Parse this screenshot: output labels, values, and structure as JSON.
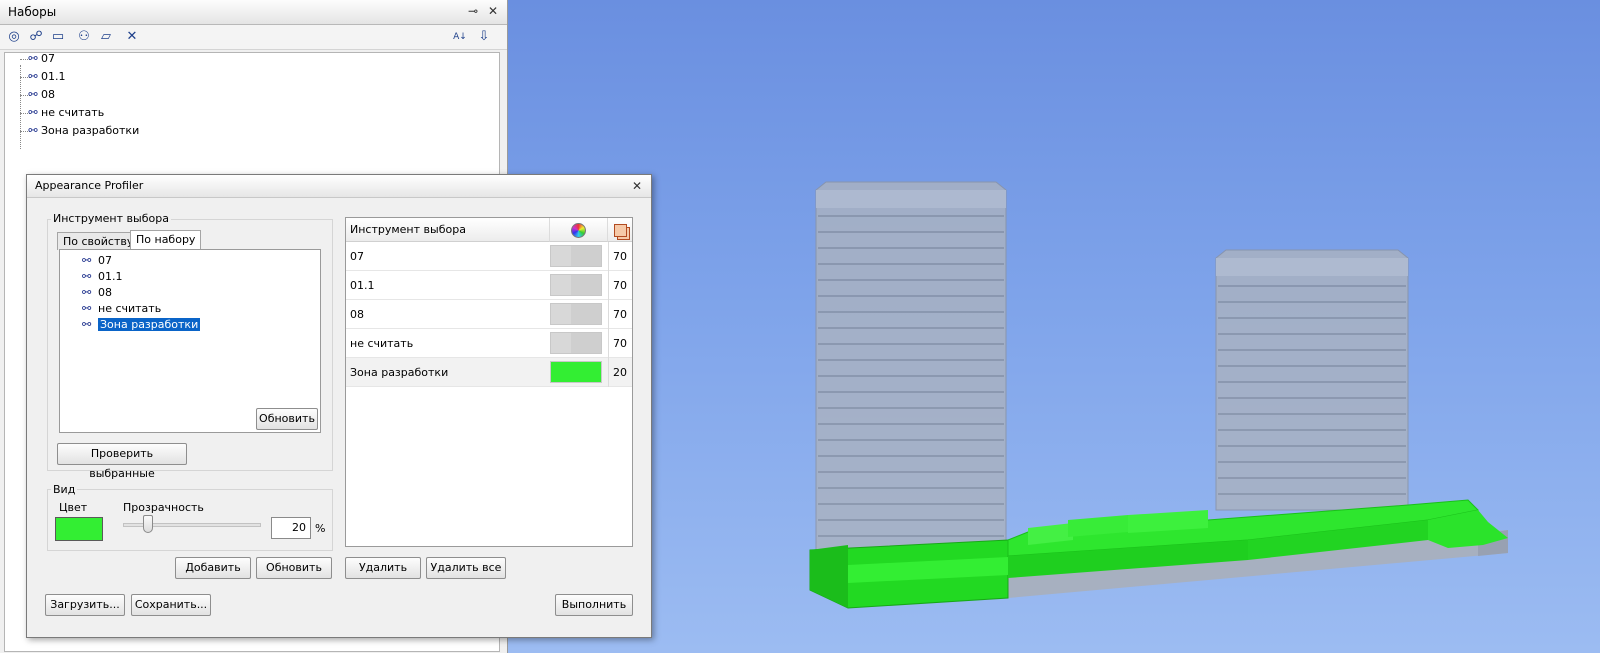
{
  "sets_panel": {
    "title": "Наборы",
    "pin_glyph": "⊸",
    "close_glyph": "✕",
    "toolbar": [
      {
        "icon": "save-selection-icon",
        "glyph": "◎"
      },
      {
        "icon": "save-search-icon",
        "glyph": "☍"
      },
      {
        "icon": "new-folder-icon",
        "glyph": "▭"
      },
      {
        "icon": "duplicate-icon",
        "glyph": "⚇"
      },
      {
        "icon": "add-comment-icon",
        "glyph": "▱"
      },
      {
        "icon": "delete-icon",
        "glyph": "✕"
      },
      {
        "icon": "sort-az-icon",
        "glyph": "A↓"
      },
      {
        "icon": "import-export-icon",
        "glyph": "⇩"
      }
    ],
    "items": [
      {
        "label": "07",
        "icon": "binoculars-icon"
      },
      {
        "label": "01.1",
        "icon": "binoculars-icon"
      },
      {
        "label": "08",
        "icon": "binoculars-icon"
      },
      {
        "label": "не считать",
        "icon": "binoculars-icon"
      },
      {
        "label": "Зона разработки",
        "icon": "binoculars-icon"
      }
    ]
  },
  "profiler": {
    "title": "Appearance Profiler",
    "close_glyph": "✕",
    "selector_group_label": "Инструмент выбора",
    "tabs": [
      {
        "label": "По свойству",
        "active": false
      },
      {
        "label": "По набору",
        "active": true
      }
    ],
    "set_list": [
      {
        "label": "07",
        "selected": false
      },
      {
        "label": "01.1",
        "selected": false
      },
      {
        "label": "08",
        "selected": false
      },
      {
        "label": "не считать",
        "selected": false
      },
      {
        "label": "Зона разработки",
        "selected": true
      }
    ],
    "refresh_list_button": "Обновить",
    "test_selected_button": "Проверить выбранные",
    "view_group_label": "Вид",
    "color_label": "Цвет",
    "transparency_label": "Прозрачность",
    "transparency_value": "20",
    "percent_sign": "%",
    "current_color": "#33ee33",
    "slider_level_percent": 20,
    "table": {
      "header": "Инструмент выбора",
      "color_col_icon": "color-wheel-icon",
      "transparency_col_icon": "transparency-icon",
      "rows": [
        {
          "name": "07",
          "transparency": "70",
          "color": "#d6d6d6"
        },
        {
          "name": "01.1",
          "transparency": "70",
          "color": "#d6d6d6"
        },
        {
          "name": "08",
          "transparency": "70",
          "color": "#d6d6d6"
        },
        {
          "name": "не считать",
          "transparency": "70",
          "color": "#d6d6d6"
        },
        {
          "name": "Зона разработки",
          "transparency": "20",
          "color": "#33ee33"
        }
      ]
    },
    "buttons": {
      "add": "Добавить",
      "update": "Обновить",
      "delete": "Удалить",
      "delete_all": "Удалить все",
      "load": "Загрузить...",
      "save": "Сохранить...",
      "run": "Выполнить"
    }
  },
  "colors": {
    "selection": "#0a64c8",
    "green_zone": "#2ee62e",
    "viewport_top": "#6a8fe0",
    "viewport_bottom": "#9cbcf2"
  }
}
